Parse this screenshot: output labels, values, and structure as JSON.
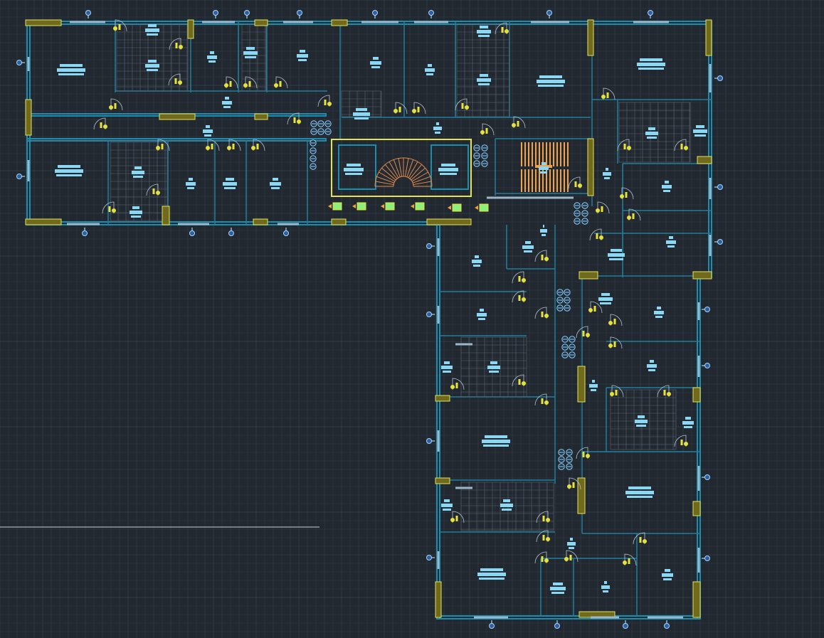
{
  "drawing": {
    "background": "#212830",
    "wall_color": "#1b8eb0",
    "column_color": "#e4e25a",
    "label_color": "#8ad8f4",
    "door_color": "#e6e23a",
    "stair_color": "#e28a4a"
  }
}
